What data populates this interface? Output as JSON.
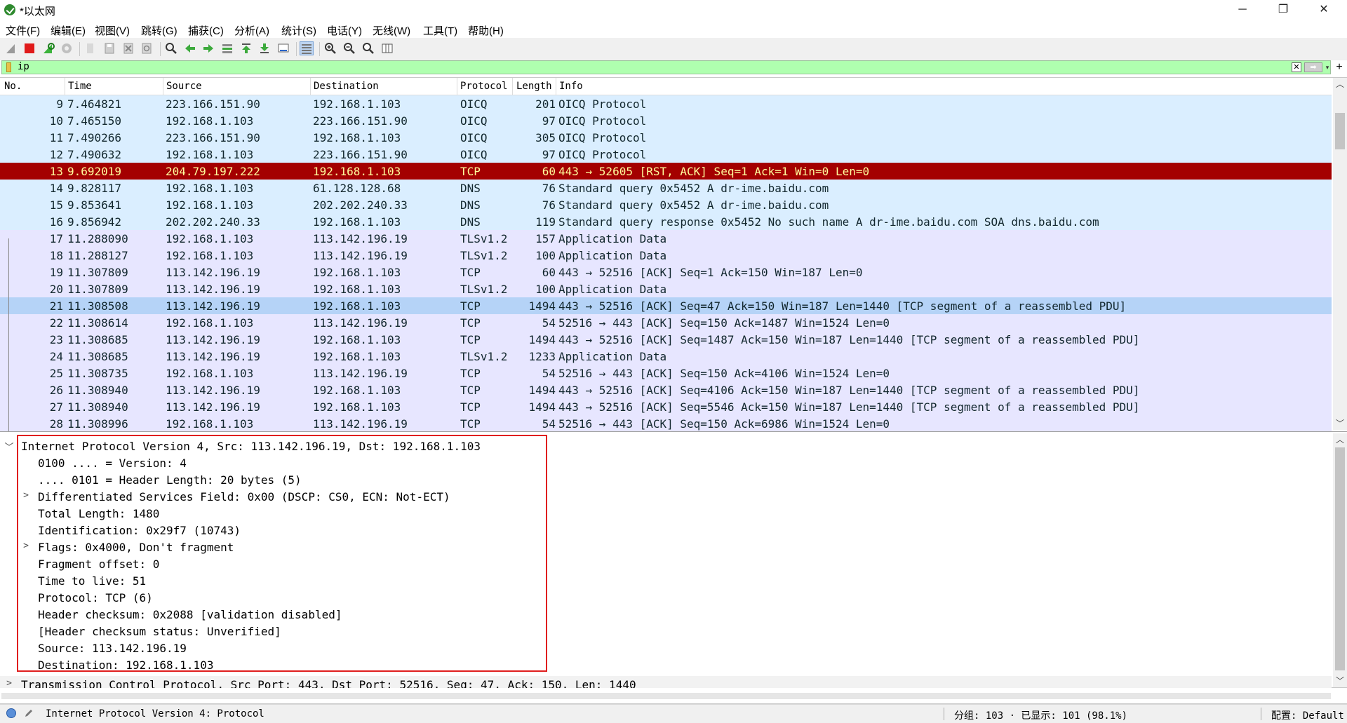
{
  "window": {
    "title": "*以太网",
    "minimize": "─",
    "maximize": "❐",
    "close": "✕"
  },
  "menu": [
    "文件(F)",
    "编辑(E)",
    "视图(V)",
    "跳转(G)",
    "捕获(C)",
    "分析(A)",
    "统计(S)",
    "电话(Y)",
    "无线(W)",
    "工具(T)",
    "帮助(H)"
  ],
  "toolbar_icons": [
    "shark-fin-start-icon",
    "stop-capture-icon",
    "restart-capture-icon",
    "capture-options-icon",
    "open-file-icon",
    "save-file-icon",
    "close-file-icon",
    "reload-file-icon",
    "find-packet-icon",
    "go-back-icon",
    "go-forward-icon",
    "go-to-packet-icon",
    "go-first-icon",
    "go-last-icon",
    "auto-scroll-icon",
    "colorize-icon",
    "zoom-in-icon",
    "zoom-out-icon",
    "zoom-normal-icon",
    "resize-columns-icon"
  ],
  "filter": {
    "value": "ip",
    "clear": "✕",
    "apply": "➡",
    "dropdown": "▾",
    "add": "+"
  },
  "packet_list": {
    "headers": {
      "no": "No.",
      "time": "Time",
      "source": "Source",
      "destination": "Destination",
      "protocol": "Protocol",
      "length": "Length",
      "info": "Info"
    },
    "rows": [
      {
        "no": "9",
        "time": "7.464821",
        "src": "223.166.151.90",
        "dst": "192.168.1.103",
        "proto": "OICQ",
        "len": "201",
        "info": "OICQ Protocol",
        "bg": "#daeeff",
        "fg": "#12272e"
      },
      {
        "no": "10",
        "time": "7.465150",
        "src": "192.168.1.103",
        "dst": "223.166.151.90",
        "proto": "OICQ",
        "len": "97",
        "info": "OICQ Protocol",
        "bg": "#daeeff",
        "fg": "#12272e"
      },
      {
        "no": "11",
        "time": "7.490266",
        "src": "223.166.151.90",
        "dst": "192.168.1.103",
        "proto": "OICQ",
        "len": "305",
        "info": "OICQ Protocol",
        "bg": "#daeeff",
        "fg": "#12272e"
      },
      {
        "no": "12",
        "time": "7.490632",
        "src": "192.168.1.103",
        "dst": "223.166.151.90",
        "proto": "OICQ",
        "len": "97",
        "info": "OICQ Protocol",
        "bg": "#daeeff",
        "fg": "#12272e"
      },
      {
        "no": "13",
        "time": "9.692019",
        "src": "204.79.197.222",
        "dst": "192.168.1.103",
        "proto": "TCP",
        "len": "60",
        "info": "443 → 52605 [RST, ACK] Seq=1 Ack=1 Win=0 Len=0",
        "bg": "#a40000",
        "fg": "#fffc9c"
      },
      {
        "no": "14",
        "time": "9.828117",
        "src": "192.168.1.103",
        "dst": "61.128.128.68",
        "proto": "DNS",
        "len": "76",
        "info": "Standard query 0x5452 A dr-ime.baidu.com",
        "bg": "#daeeff",
        "fg": "#12272e"
      },
      {
        "no": "15",
        "time": "9.853641",
        "src": "192.168.1.103",
        "dst": "202.202.240.33",
        "proto": "DNS",
        "len": "76",
        "info": "Standard query 0x5452 A dr-ime.baidu.com",
        "bg": "#daeeff",
        "fg": "#12272e"
      },
      {
        "no": "16",
        "time": "9.856942",
        "src": "202.202.240.33",
        "dst": "192.168.1.103",
        "proto": "DNS",
        "len": "119",
        "info": "Standard query response 0x5452 No such name A dr-ime.baidu.com SOA dns.baidu.com",
        "bg": "#daeeff",
        "fg": "#12272e"
      },
      {
        "no": "17",
        "time": "11.288090",
        "src": "192.168.1.103",
        "dst": "113.142.196.19",
        "proto": "TLSv1.2",
        "len": "157",
        "info": "Application Data",
        "bg": "#e7e6ff",
        "fg": "#12272e"
      },
      {
        "no": "18",
        "time": "11.288127",
        "src": "192.168.1.103",
        "dst": "113.142.196.19",
        "proto": "TLSv1.2",
        "len": "100",
        "info": "Application Data",
        "bg": "#e7e6ff",
        "fg": "#12272e"
      },
      {
        "no": "19",
        "time": "11.307809",
        "src": "113.142.196.19",
        "dst": "192.168.1.103",
        "proto": "TCP",
        "len": "60",
        "info": "443 → 52516 [ACK] Seq=1 Ack=150 Win=187 Len=0",
        "bg": "#e7e6ff",
        "fg": "#12272e"
      },
      {
        "no": "20",
        "time": "11.307809",
        "src": "113.142.196.19",
        "dst": "192.168.1.103",
        "proto": "TLSv1.2",
        "len": "100",
        "info": "Application Data",
        "bg": "#e7e6ff",
        "fg": "#12272e"
      },
      {
        "no": "21",
        "time": "11.308508",
        "src": "113.142.196.19",
        "dst": "192.168.1.103",
        "proto": "TCP",
        "len": "1494",
        "info": "443 → 52516 [ACK] Seq=47 Ack=150 Win=187 Len=1440 [TCP segment of a reassembled PDU]",
        "bg": "#b5d3f7",
        "fg": "#12272e"
      },
      {
        "no": "22",
        "time": "11.308614",
        "src": "192.168.1.103",
        "dst": "113.142.196.19",
        "proto": "TCP",
        "len": "54",
        "info": "52516 → 443 [ACK] Seq=150 Ack=1487 Win=1524 Len=0",
        "bg": "#e7e6ff",
        "fg": "#12272e"
      },
      {
        "no": "23",
        "time": "11.308685",
        "src": "113.142.196.19",
        "dst": "192.168.1.103",
        "proto": "TCP",
        "len": "1494",
        "info": "443 → 52516 [ACK] Seq=1487 Ack=150 Win=187 Len=1440 [TCP segment of a reassembled PDU]",
        "bg": "#e7e6ff",
        "fg": "#12272e"
      },
      {
        "no": "24",
        "time": "11.308685",
        "src": "113.142.196.19",
        "dst": "192.168.1.103",
        "proto": "TLSv1.2",
        "len": "1233",
        "info": "Application Data",
        "bg": "#e7e6ff",
        "fg": "#12272e"
      },
      {
        "no": "25",
        "time": "11.308735",
        "src": "192.168.1.103",
        "dst": "113.142.196.19",
        "proto": "TCP",
        "len": "54",
        "info": "52516 → 443 [ACK] Seq=150 Ack=4106 Win=1524 Len=0",
        "bg": "#e7e6ff",
        "fg": "#12272e"
      },
      {
        "no": "26",
        "time": "11.308940",
        "src": "113.142.196.19",
        "dst": "192.168.1.103",
        "proto": "TCP",
        "len": "1494",
        "info": "443 → 52516 [ACK] Seq=4106 Ack=150 Win=187 Len=1440 [TCP segment of a reassembled PDU]",
        "bg": "#e7e6ff",
        "fg": "#12272e"
      },
      {
        "no": "27",
        "time": "11.308940",
        "src": "113.142.196.19",
        "dst": "192.168.1.103",
        "proto": "TCP",
        "len": "1494",
        "info": "443 → 52516 [ACK] Seq=5546 Ack=150 Win=187 Len=1440 [TCP segment of a reassembled PDU]",
        "bg": "#e7e6ff",
        "fg": "#12272e"
      },
      {
        "no": "28",
        "time": "11.308996",
        "src": "192.168.1.103",
        "dst": "113.142.196.19",
        "proto": "TCP",
        "len": "54",
        "info": "52516 → 443 [ACK] Seq=150 Ack=6986 Win=1524 Len=0",
        "bg": "#e7e6ff",
        "fg": "#12272e"
      }
    ]
  },
  "details": {
    "rows": [
      {
        "text": "Internet Protocol Version 4, Src: 113.142.196.19, Dst: 192.168.1.103",
        "arrow": "﹀",
        "indent": 0
      },
      {
        "text": "0100 .... = Version: 4",
        "arrow": "",
        "indent": 1
      },
      {
        "text": ".... 0101 = Header Length: 20 bytes (5)",
        "arrow": "",
        "indent": 1
      },
      {
        "text": "Differentiated Services Field: 0x00 (DSCP: CS0, ECN: Not-ECT)",
        "arrow": ">",
        "indent": 1
      },
      {
        "text": "Total Length: 1480",
        "arrow": "",
        "indent": 1
      },
      {
        "text": "Identification: 0x29f7 (10743)",
        "arrow": "",
        "indent": 1
      },
      {
        "text": "Flags: 0x4000, Don't fragment",
        "arrow": ">",
        "indent": 1
      },
      {
        "text": "Fragment offset: 0",
        "arrow": "",
        "indent": 1
      },
      {
        "text": "Time to live: 51",
        "arrow": "",
        "indent": 1
      },
      {
        "text": "Protocol: TCP (6)",
        "arrow": "",
        "indent": 1
      },
      {
        "text": "Header checksum: 0x2088 [validation disabled]",
        "arrow": "",
        "indent": 1
      },
      {
        "text": "[Header checksum status: Unverified]",
        "arrow": "",
        "indent": 1
      },
      {
        "text": "Source: 113.142.196.19",
        "arrow": "",
        "indent": 1
      },
      {
        "text": "Destination: 192.168.1.103",
        "arrow": "",
        "indent": 1
      },
      {
        "text": "Transmission Control Protocol, Src Port: 443, Dst Port: 52516, Seq: 47, Ack: 150, Len: 1440",
        "arrow": ">",
        "indent": 0
      }
    ]
  },
  "status": {
    "field": "Internet Protocol Version 4: Protocol",
    "packets": "分组: 103 · 已显示: 101 (98.1%)",
    "profile": "配置: Default"
  }
}
